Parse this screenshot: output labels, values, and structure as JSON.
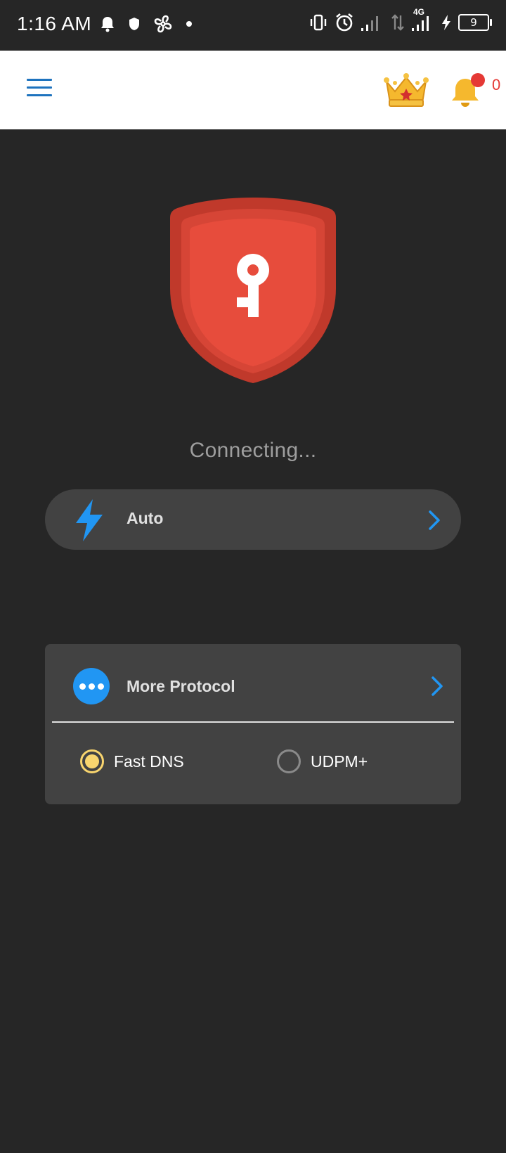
{
  "status_bar": {
    "time": "1:16 AM",
    "network_label": "4G",
    "battery_level": "9",
    "icons_left": [
      "bell-icon",
      "shield-icon",
      "fan-icon",
      "dot-icon"
    ],
    "icons_right": [
      "vibrate-icon",
      "alarm-icon",
      "signal-icon",
      "data-arrows-icon",
      "signal-4g-icon",
      "charging-icon",
      "battery-icon"
    ]
  },
  "app_bar": {
    "menu_icon": "hamburger-menu-icon",
    "premium_icon": "crown-icon",
    "notification_icon": "bell-icon",
    "notification_count": "0"
  },
  "main": {
    "shield_icon": "shield-key-icon",
    "connection_status": "Connecting...",
    "server": {
      "icon": "lightning-bolt-icon",
      "label": "Auto"
    },
    "protocol_card": {
      "icon": "more-dots-icon",
      "title": "More Protocol",
      "options": [
        {
          "label": "Fast DNS",
          "selected": true
        },
        {
          "label": "UDPM+",
          "selected": false
        }
      ]
    }
  },
  "colors": {
    "background": "#262626",
    "card": "#424242",
    "accent_blue": "#2196f3",
    "shield_red": "#e74c3c",
    "radio_selected": "#f9d56e",
    "badge_red": "#e53935"
  }
}
